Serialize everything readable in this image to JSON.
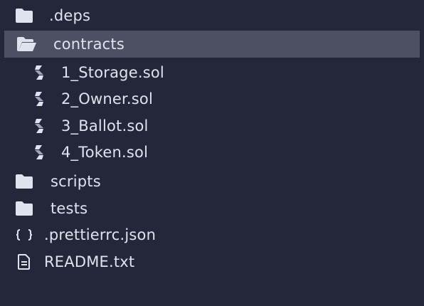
{
  "tree": {
    "items": [
      {
        "label": ".deps",
        "kind": "folder",
        "icon": "folder-icon"
      },
      {
        "label": "contracts",
        "kind": "folder-open",
        "icon": "folder-open-icon",
        "selected": true
      },
      {
        "label": "1_Storage.sol",
        "kind": "file",
        "icon": "solidity-icon"
      },
      {
        "label": "2_Owner.sol",
        "kind": "file",
        "icon": "solidity-icon"
      },
      {
        "label": "3_Ballot.sol",
        "kind": "file",
        "icon": "solidity-icon"
      },
      {
        "label": "4_Token.sol",
        "kind": "file",
        "icon": "solidity-icon"
      },
      {
        "label": "scripts",
        "kind": "folder",
        "icon": "folder-icon"
      },
      {
        "label": "tests",
        "kind": "folder",
        "icon": "folder-icon"
      },
      {
        "label": ".prettierrc.json",
        "kind": "file",
        "icon": "json-braces-icon"
      },
      {
        "label": "README.txt",
        "kind": "file",
        "icon": "text-file-icon"
      }
    ]
  },
  "colors": {
    "background": "#24273a",
    "selected": "#4d5063",
    "text": "#dfe3ee",
    "icon": "#dfe3ee"
  }
}
